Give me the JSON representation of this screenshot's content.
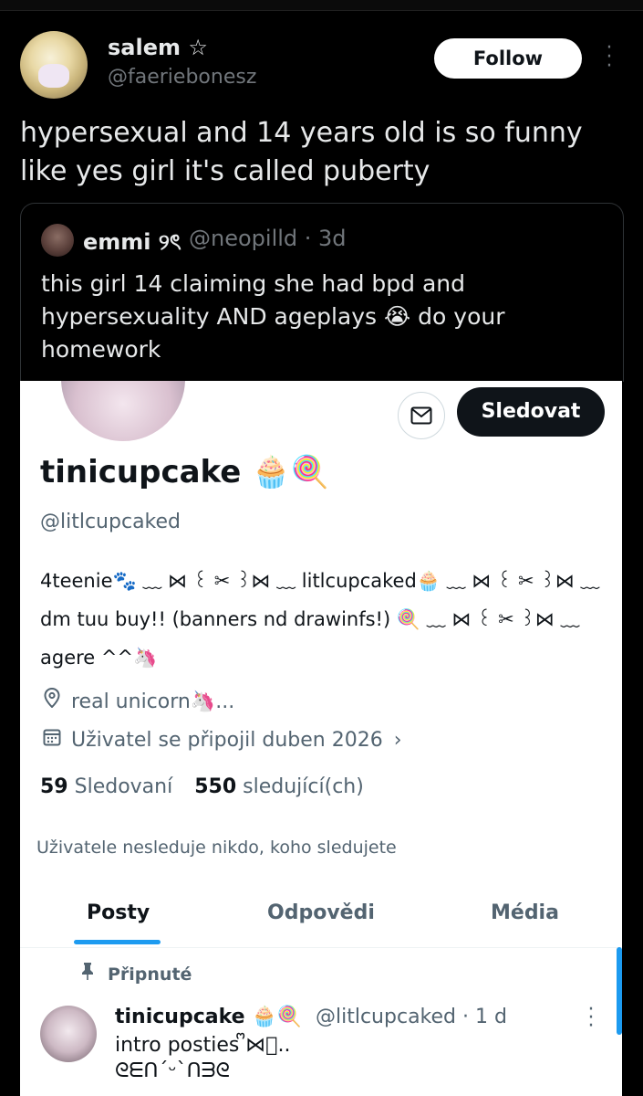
{
  "author": {
    "name": "salem ☆",
    "handle": "@faeriebonesz",
    "follow_label": "Follow",
    "more_icon": "more-vertical-icon"
  },
  "tweet": {
    "text": "hypersexual and 14 years old is so funny\nlike yes girl it's called puberty"
  },
  "quote": {
    "name": "emmi ୨ৎ",
    "handle": "@neopilld · 3d",
    "text": "this girl 14 claiming she had bpd and\nhypersexuality AND ageplays 😭 do your\nhomework"
  },
  "profile": {
    "message_icon": "mail-icon",
    "follow_label": "Sledovat",
    "name": "tinicupcake 🧁🍭",
    "handle": "@litlcupcaked",
    "bio": "4teenie🐾 ﹏ ⋈ ꒰ ✂ ꒱⋈ ﹏ litlcupcaked🧁 ﹏ ⋈ ꒰ ✂ ꒱⋈ ﹏\ndm tuu buy!! (banners nd drawinfs!) 🍭 ﹏ ⋈ ꒰ ✂ ꒱⋈ ﹏\nagere ^^🦄",
    "location": "real unicorn🦄...",
    "joined": "Uživatel se připojil duben 2026",
    "following_count": "59",
    "following_label": "Sledovaní",
    "followers_count": "550",
    "followers_label": "sledující(ch)",
    "followed_note": "Uživatele nesleduje nikdo, koho sledujete"
  },
  "tabs": [
    {
      "label": "Posty",
      "active": true
    },
    {
      "label": "Odpovědi",
      "active": false
    },
    {
      "label": "Média",
      "active": false
    }
  ],
  "pinned_post": {
    "pinned_label": "Připnuté",
    "name": "tinicupcake 🧁🍭",
    "handle": "@litlcupcaked · 1 d",
    "text": "intro posties ᩚ⋈ᩚ..\nᘓᗴᑎ´ᵕ`ᑎᗱᘓ"
  },
  "colors": {
    "background": "#000000",
    "accent": "#1d9bf0",
    "secondary_text": "#71767b"
  }
}
